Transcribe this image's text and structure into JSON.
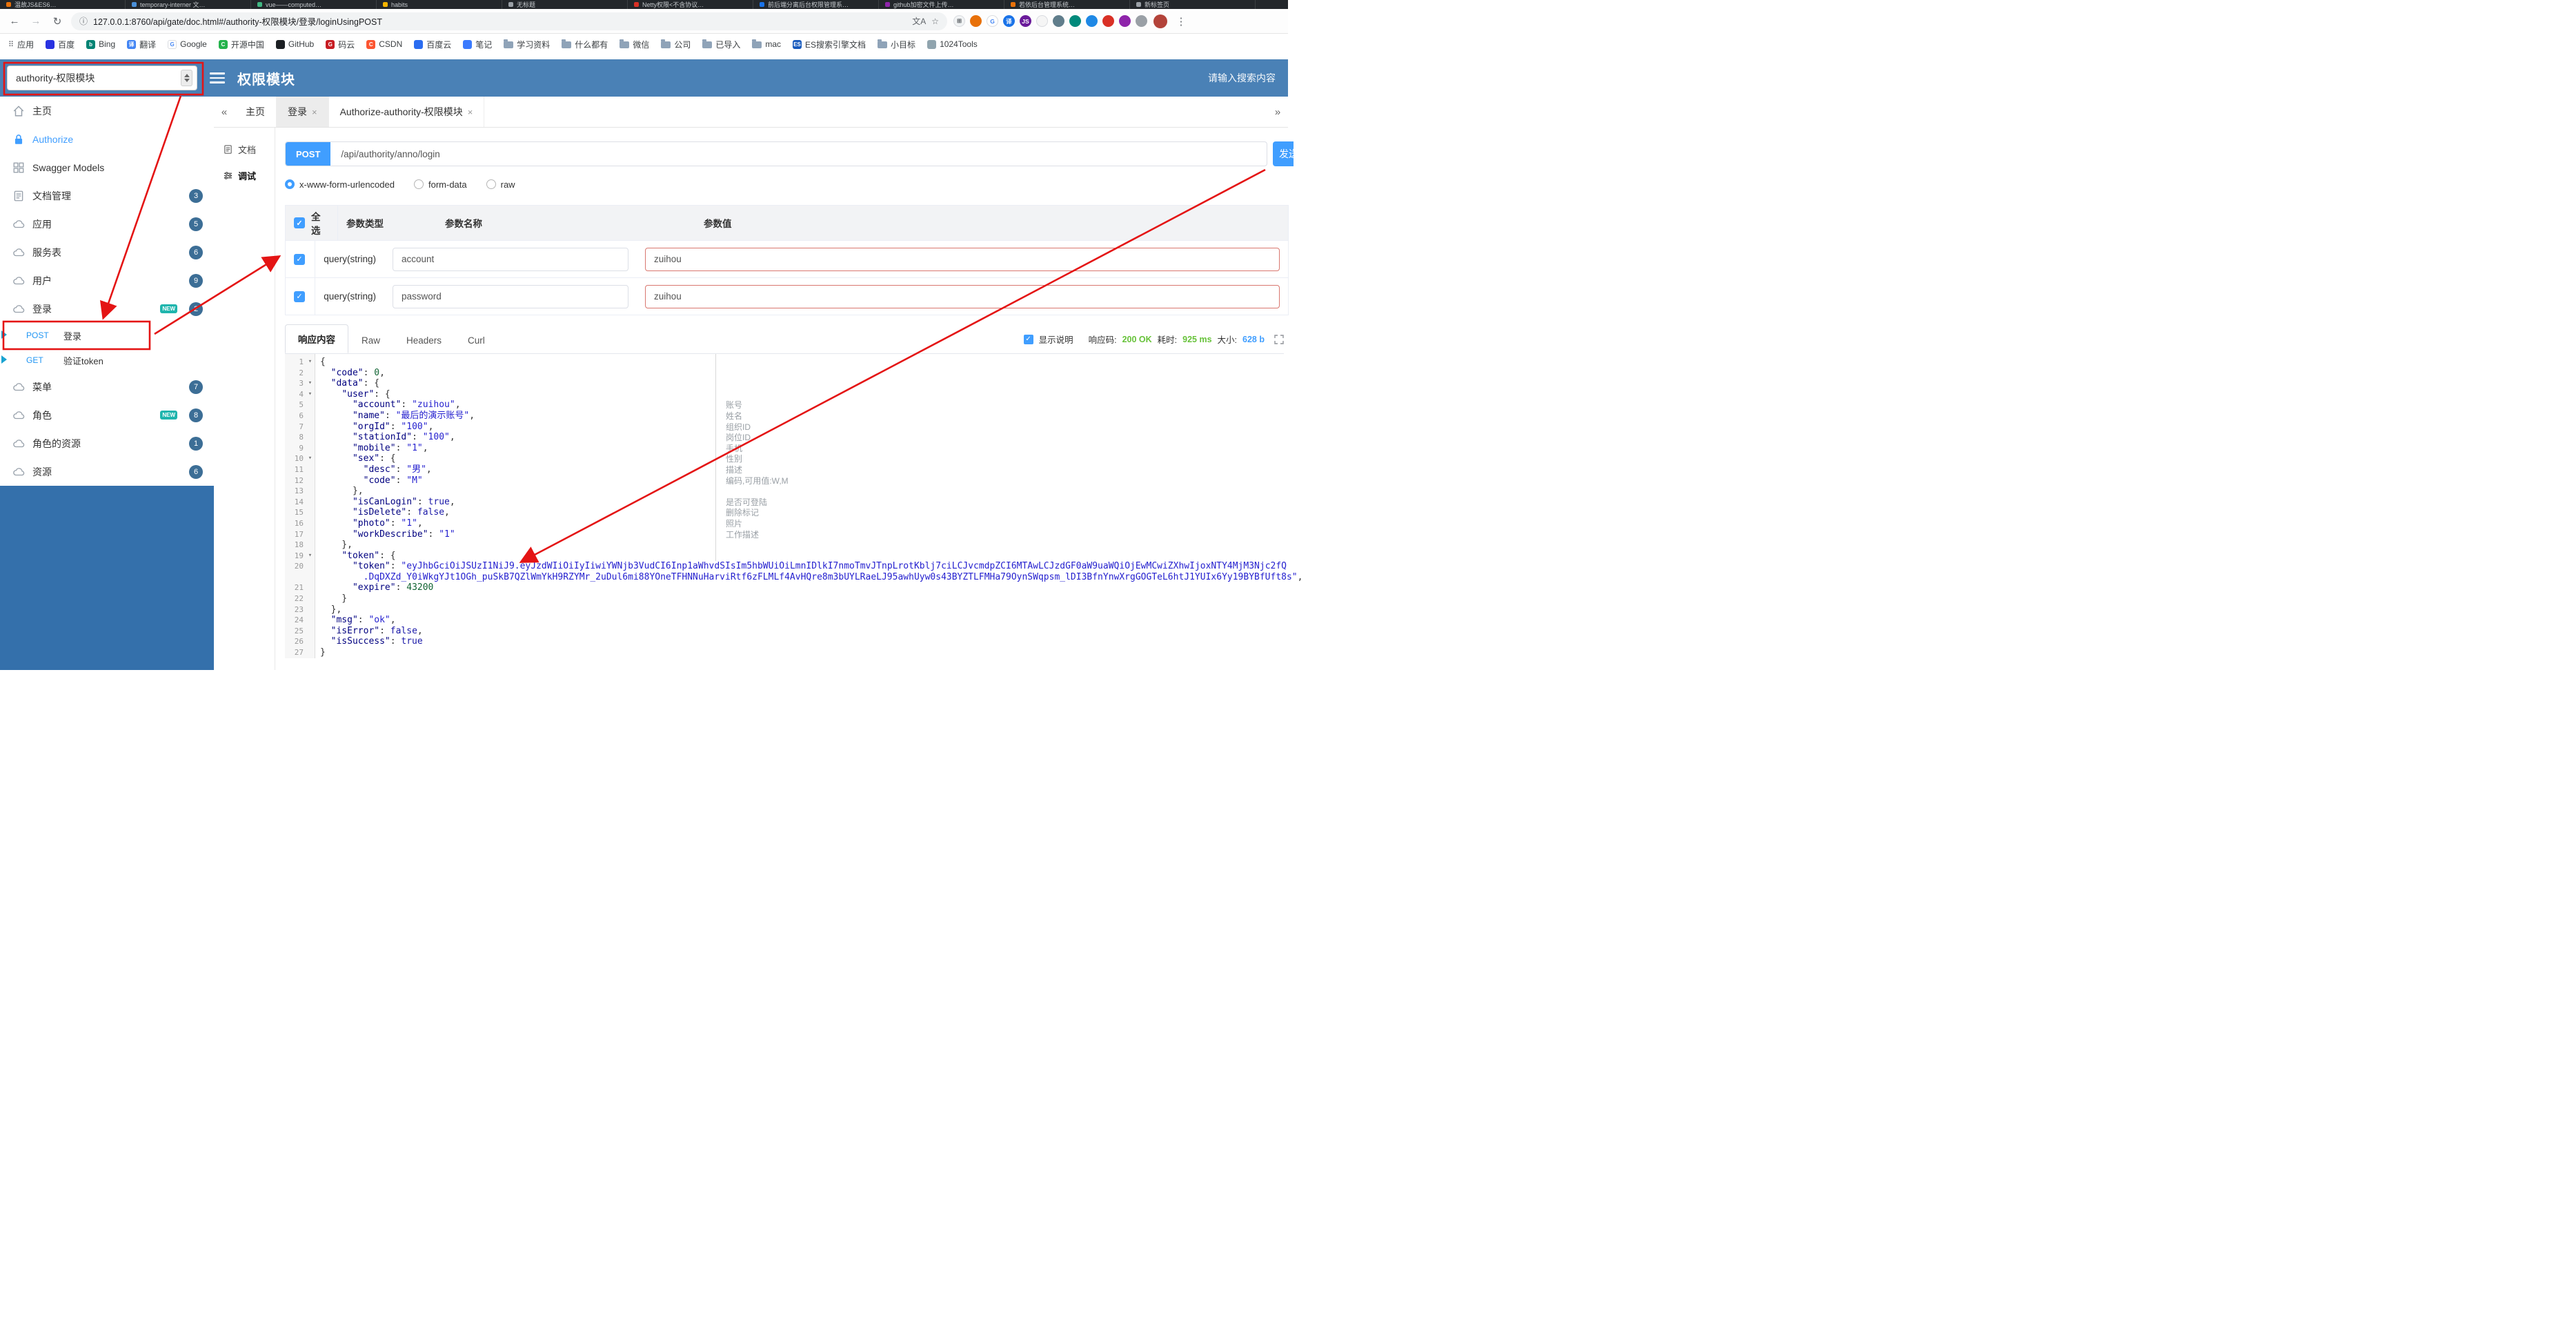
{
  "colors": {
    "header_bg": "#4a81b6",
    "sidebar_fill": "#3470ab",
    "accent_blue": "#409eff",
    "method_blue": "#2196f3",
    "badge_bg": "#3c6e96",
    "new_tag": "#1fb5ad",
    "annotation_red": "#e41414",
    "success_green": "#67c23a",
    "size_blue": "#409eff",
    "value_input_border": "#d9776f"
  },
  "glyphs": {
    "check": "✓",
    "close": "×",
    "caret_down": "▾",
    "collapse": "«",
    "expand": "»",
    "apps": "⠿"
  },
  "browser": {
    "icons": {
      "back": "←",
      "forward": "→",
      "reload": "↻",
      "info": "ⓘ",
      "star": "☆",
      "more": "⋮"
    },
    "url": "127.0.0.1:8760/api/gate/doc.html#/authority-权限模块/登录/loginUsingPOST",
    "tabs": [
      {
        "title": "温故JS&ES6…",
        "color": "#e8710a"
      },
      {
        "title": "temporary-interner 文…",
        "color": "#4a90d9"
      },
      {
        "title": "vue——computed…",
        "color": "#41b883"
      },
      {
        "title": "habits",
        "color": "#f4b400"
      },
      {
        "title": "无标题",
        "color": "#9aa0a6"
      },
      {
        "title": "Netty权限<不含协议…",
        "color": "#d93025"
      },
      {
        "title": "前后端分离后台权限管理系…",
        "color": "#1a73e8"
      },
      {
        "title": "github加密文件上传…",
        "color": "#8e24aa"
      },
      {
        "title": "若依后台管理系统…",
        "color": "#e8710a"
      },
      {
        "title": "新标签页",
        "color": "#9aa0a6"
      }
    ],
    "extensions": [
      {
        "bg": "#f1f3f4",
        "fg": "#5f6368",
        "g": "⊞",
        "border": true
      },
      {
        "bg": "#e8710a",
        "g": ""
      },
      {
        "bg": "#ffffff",
        "fg": "#4285f4",
        "g": "G",
        "border": true
      },
      {
        "bg": "#1a73e8",
        "fg": "#ffffff",
        "g": "译"
      },
      {
        "bg": "#6a1b9a",
        "fg": "#ffffff",
        "g": "JS"
      },
      {
        "bg": "#f5f5f5",
        "g": "",
        "border": true
      },
      {
        "bg": "#607d8b",
        "g": ""
      },
      {
        "bg": "#00897b",
        "g": ""
      },
      {
        "bg": "#1e88e5",
        "g": ""
      },
      {
        "bg": "#d93025",
        "g": ""
      },
      {
        "bg": "#8e24aa",
        "g": ""
      },
      {
        "bg": "#9aa0a6",
        "g": ""
      }
    ],
    "bookmarks": [
      {
        "label": "应用",
        "type": "apps"
      },
      {
        "label": "百度",
        "type": "site",
        "color": "#2932e1",
        "letter": ""
      },
      {
        "label": "Bing",
        "type": "site",
        "color": "#008373",
        "letter": "b"
      },
      {
        "label": "翻译",
        "type": "site",
        "color": "#4285f4",
        "letter": "译"
      },
      {
        "label": "Google",
        "type": "site",
        "color": "#ffffff",
        "fg": "#4285f4",
        "letter": "G",
        "border": true
      },
      {
        "label": "开源中国",
        "type": "site",
        "color": "#24b34b",
        "letter": "C"
      },
      {
        "label": "GitHub",
        "type": "site",
        "color": "#1b1f23",
        "letter": ""
      },
      {
        "label": "码云",
        "type": "site",
        "color": "#c71d23",
        "letter": "G"
      },
      {
        "label": "CSDN",
        "type": "site",
        "color": "#fc5531",
        "letter": "C"
      },
      {
        "label": "百度云",
        "type": "site",
        "color": "#2a6cf0",
        "letter": ""
      },
      {
        "label": "笔记",
        "type": "site",
        "color": "#3a7afe",
        "letter": ""
      },
      {
        "label": "学习资料",
        "type": "folder"
      },
      {
        "label": "什么都有",
        "type": "folder"
      },
      {
        "label": "微信",
        "type": "folder"
      },
      {
        "label": "公司",
        "type": "folder"
      },
      {
        "label": "已导入",
        "type": "folder"
      },
      {
        "label": "mac",
        "type": "folder"
      },
      {
        "label": "ES搜索引擎文档",
        "type": "site",
        "color": "#185abd",
        "letter": "ES"
      },
      {
        "label": "小目标",
        "type": "folder"
      },
      {
        "label": "1024Tools",
        "type": "site",
        "color": "#90a4ae",
        "letter": ""
      }
    ]
  },
  "header": {
    "module_select": "authority-权限模块",
    "title": "权限模块",
    "search_placeholder": "请输入搜索内容"
  },
  "sidebar": {
    "new_label": "NEW",
    "items": [
      {
        "id": "home",
        "icon": "home",
        "label": "主页"
      },
      {
        "id": "authorize",
        "icon": "lock",
        "label": "Authorize",
        "auth": true
      },
      {
        "id": "swagger-models",
        "icon": "models",
        "label": "Swagger Models"
      },
      {
        "id": "doc-manage",
        "icon": "doc",
        "label": "文档管理",
        "badge": "3"
      },
      {
        "id": "app",
        "icon": "cloud",
        "label": "应用",
        "badge": "5"
      },
      {
        "id": "service",
        "icon": "cloud",
        "label": "服务表",
        "badge": "6"
      },
      {
        "id": "user",
        "icon": "cloud",
        "label": "用户",
        "badge": "9"
      },
      {
        "id": "login",
        "icon": "cloud",
        "label": "登录",
        "badge": "2",
        "new": true
      },
      {
        "id": "login-post",
        "type": "sub",
        "method": "POST",
        "label": "登录",
        "selected": true
      },
      {
        "id": "token-get",
        "type": "sub",
        "method": "GET",
        "label": "验证token"
      },
      {
        "id": "menu",
        "icon": "cloud",
        "label": "菜单",
        "badge": "7"
      },
      {
        "id": "role",
        "icon": "cloud",
        "label": "角色",
        "badge": "8",
        "new": true
      },
      {
        "id": "role-resource",
        "icon": "cloud",
        "label": "角色的资源",
        "badge": "1"
      },
      {
        "id": "resource",
        "icon": "cloud",
        "label": "资源",
        "badge": "6"
      }
    ]
  },
  "tabs": {
    "items": [
      {
        "label": "主页",
        "closable": false
      },
      {
        "label": "登录",
        "closable": true,
        "active": true
      },
      {
        "label": "Authorize-authority-权限模块",
        "closable": true
      }
    ]
  },
  "doc_nav": [
    {
      "id": "doc",
      "label": "文档"
    },
    {
      "id": "debug",
      "label": "调试",
      "active": true
    }
  ],
  "endpoint": {
    "method": "POST",
    "url": "/api/authority/anno/login",
    "send_label": "发送"
  },
  "body_type": [
    {
      "label": "x-www-form-urlencoded",
      "selected": true
    },
    {
      "label": "form-data",
      "selected": false
    },
    {
      "label": "raw",
      "selected": false
    }
  ],
  "params": {
    "headers": {
      "select_all": "全选",
      "type": "参数类型",
      "name": "参数名称",
      "value": "参数值"
    },
    "rows": [
      {
        "checked": true,
        "type": "query(string)",
        "name": "account",
        "value": "zuihou"
      },
      {
        "checked": true,
        "type": "query(string)",
        "name": "password",
        "value": "zuihou"
      }
    ]
  },
  "response": {
    "tabs": [
      {
        "label": "响应内容",
        "active": true
      },
      {
        "label": "Raw",
        "active": false
      },
      {
        "label": "Headers",
        "active": false
      },
      {
        "label": "Curl",
        "active": false
      }
    ],
    "show_desc_label": "显示说明",
    "status": {
      "code_label": "响应码:",
      "code": "200 OK",
      "time_label": "耗时:",
      "time": "925 ms",
      "size_label": "大小:",
      "size": "628 b"
    }
  },
  "code": {
    "lines": [
      {
        "ln": 1,
        "f": true,
        "t": [
          [
            "p",
            "{"
          ]
        ]
      },
      {
        "ln": 2,
        "t": [
          [
            "p",
            "  "
          ],
          [
            "k",
            "\"code\""
          ],
          [
            "p",
            ": "
          ],
          [
            "n",
            "0"
          ],
          [
            "p",
            ","
          ]
        ]
      },
      {
        "ln": 3,
        "f": true,
        "t": [
          [
            "p",
            "  "
          ],
          [
            "k",
            "\"data\""
          ],
          [
            "p",
            ": {"
          ]
        ]
      },
      {
        "ln": 4,
        "f": true,
        "t": [
          [
            "p",
            "    "
          ],
          [
            "k",
            "\"user\""
          ],
          [
            "p",
            ": {"
          ]
        ]
      },
      {
        "ln": 5,
        "d": "账号",
        "t": [
          [
            "p",
            "      "
          ],
          [
            "k",
            "\"account\""
          ],
          [
            "p",
            ": "
          ],
          [
            "s",
            "\"zuihou\""
          ],
          [
            "p",
            ","
          ]
        ]
      },
      {
        "ln": 6,
        "d": "姓名",
        "t": [
          [
            "p",
            "      "
          ],
          [
            "k",
            "\"name\""
          ],
          [
            "p",
            ": "
          ],
          [
            "s",
            "\"最后的演示账号\""
          ],
          [
            "p",
            ","
          ]
        ]
      },
      {
        "ln": 7,
        "d": "组织ID",
        "t": [
          [
            "p",
            "      "
          ],
          [
            "k",
            "\"orgId\""
          ],
          [
            "p",
            ": "
          ],
          [
            "s",
            "\"100\""
          ],
          [
            "p",
            ","
          ]
        ]
      },
      {
        "ln": 8,
        "d": "岗位ID",
        "t": [
          [
            "p",
            "      "
          ],
          [
            "k",
            "\"stationId\""
          ],
          [
            "p",
            ": "
          ],
          [
            "s",
            "\"100\""
          ],
          [
            "p",
            ","
          ]
        ]
      },
      {
        "ln": 9,
        "d": "手机",
        "t": [
          [
            "p",
            "      "
          ],
          [
            "k",
            "\"mobile\""
          ],
          [
            "p",
            ": "
          ],
          [
            "s",
            "\"1\""
          ],
          [
            "p",
            ","
          ]
        ]
      },
      {
        "ln": 10,
        "f": true,
        "d": "性别",
        "t": [
          [
            "p",
            "      "
          ],
          [
            "k",
            "\"sex\""
          ],
          [
            "p",
            ": {"
          ]
        ]
      },
      {
        "ln": 11,
        "d": "描述",
        "t": [
          [
            "p",
            "        "
          ],
          [
            "k",
            "\"desc\""
          ],
          [
            "p",
            ": "
          ],
          [
            "s",
            "\"男\""
          ],
          [
            "p",
            ","
          ]
        ]
      },
      {
        "ln": 12,
        "d": "编码,可用值:W,M",
        "t": [
          [
            "p",
            "        "
          ],
          [
            "k",
            "\"code\""
          ],
          [
            "p",
            ": "
          ],
          [
            "s",
            "\"M\""
          ]
        ]
      },
      {
        "ln": 13,
        "t": [
          [
            "p",
            "      },"
          ]
        ]
      },
      {
        "ln": 14,
        "d": "是否可登陆",
        "t": [
          [
            "p",
            "      "
          ],
          [
            "k",
            "\"isCanLogin\""
          ],
          [
            "p",
            ": "
          ],
          [
            "a",
            "true"
          ],
          [
            "p",
            ","
          ]
        ]
      },
      {
        "ln": 15,
        "d": "删除标记",
        "t": [
          [
            "p",
            "      "
          ],
          [
            "k",
            "\"isDelete\""
          ],
          [
            "p",
            ": "
          ],
          [
            "a",
            "false"
          ],
          [
            "p",
            ","
          ]
        ]
      },
      {
        "ln": 16,
        "d": "照片",
        "t": [
          [
            "p",
            "      "
          ],
          [
            "k",
            "\"photo\""
          ],
          [
            "p",
            ": "
          ],
          [
            "s",
            "\"1\""
          ],
          [
            "p",
            ","
          ]
        ]
      },
      {
        "ln": 17,
        "d": "工作描述",
        "t": [
          [
            "p",
            "      "
          ],
          [
            "k",
            "\"workDescribe\""
          ],
          [
            "p",
            ": "
          ],
          [
            "s",
            "\"1\""
          ]
        ]
      },
      {
        "ln": 18,
        "t": [
          [
            "p",
            "    },"
          ]
        ]
      },
      {
        "ln": 19,
        "f": true,
        "t": [
          [
            "p",
            "    "
          ],
          [
            "k",
            "\"token\""
          ],
          [
            "p",
            ": {"
          ]
        ]
      },
      {
        "ln": 20,
        "t": [
          [
            "p",
            "      "
          ],
          [
            "k",
            "\"token\""
          ],
          [
            "p",
            ": "
          ],
          [
            "s",
            "\"eyJhbGciOiJSUzI1NiJ9.eyJzdWIiOiIyIiwiYWNjb3VudCI6Inp1aWhvdSIsIm5hbWUiOiLmnIDlkI7nmoTmvJTnpLrotKblj7ciLCJvcmdpZCI6MTAwLCJzdGF0aW9uaWQiOjEwMCwiZXhwIjoxNTY4MjM3Njc2fQ"
          ]
        ]
      },
      {
        "ln": null,
        "t": [
          [
            "p",
            "        "
          ],
          [
            "s",
            ".DqDXZd_Y0iWkgYJt1OGh_puSkB7QZlWmYkH9RZYMr_2uDul6mi88YOneTFHNNuHarviRtf6zFLMLf4AvHQre8m3bUYLRaeLJ95awhUyw0s43BYZTLFMHa79OynSWqpsm_lDI3BfnYnwXrgGOGTeL6htJ1YUIx6Yy19BYBfUft8s\""
          ],
          [
            "p",
            ","
          ]
        ]
      },
      {
        "ln": 21,
        "t": [
          [
            "p",
            "      "
          ],
          [
            "k",
            "\"expire\""
          ],
          [
            "p",
            ": "
          ],
          [
            "n",
            "43200"
          ]
        ]
      },
      {
        "ln": 22,
        "t": [
          [
            "p",
            "    }"
          ]
        ]
      },
      {
        "ln": 23,
        "t": [
          [
            "p",
            "  },"
          ]
        ]
      },
      {
        "ln": 24,
        "t": [
          [
            "p",
            "  "
          ],
          [
            "k",
            "\"msg\""
          ],
          [
            "p",
            ": "
          ],
          [
            "s",
            "\"ok\""
          ],
          [
            "p",
            ","
          ]
        ]
      },
      {
        "ln": 25,
        "t": [
          [
            "p",
            "  "
          ],
          [
            "k",
            "\"isError\""
          ],
          [
            "p",
            ": "
          ],
          [
            "a",
            "false"
          ],
          [
            "p",
            ","
          ]
        ]
      },
      {
        "ln": 26,
        "t": [
          [
            "p",
            "  "
          ],
          [
            "k",
            "\"isSuccess\""
          ],
          [
            "p",
            ": "
          ],
          [
            "a",
            "true"
          ]
        ]
      },
      {
        "ln": 27,
        "t": [
          [
            "p",
            "}"
          ]
        ]
      }
    ]
  }
}
